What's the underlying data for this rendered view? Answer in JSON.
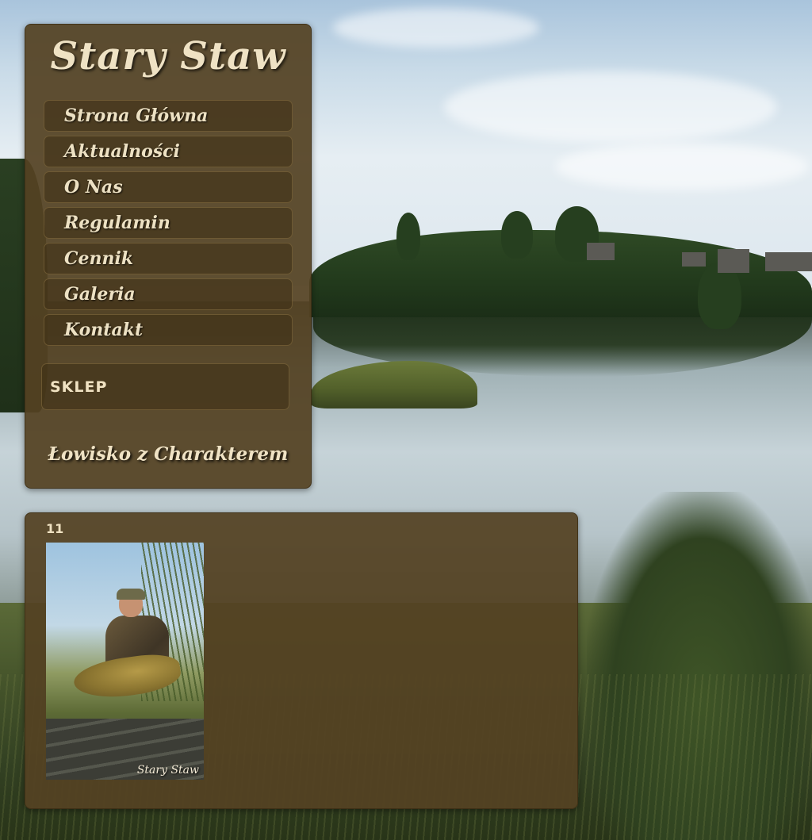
{
  "site": {
    "title": "Stary Staw",
    "tagline": "Łowisko z Charakterem"
  },
  "nav": {
    "items": [
      {
        "label": "Strona Główna"
      },
      {
        "label": "Aktualności"
      },
      {
        "label": "O Nas"
      },
      {
        "label": "Regulamin"
      },
      {
        "label": "Cennik"
      },
      {
        "label": "Galeria"
      },
      {
        "label": "Kontakt"
      }
    ],
    "shop_label": "SKLEP"
  },
  "content": {
    "gallery_title": "11",
    "photo_watermark": "Stary Staw",
    "photo_icon": "carp-catch-photo"
  },
  "colors": {
    "panel": "#544222",
    "text": "#efe2c4"
  }
}
